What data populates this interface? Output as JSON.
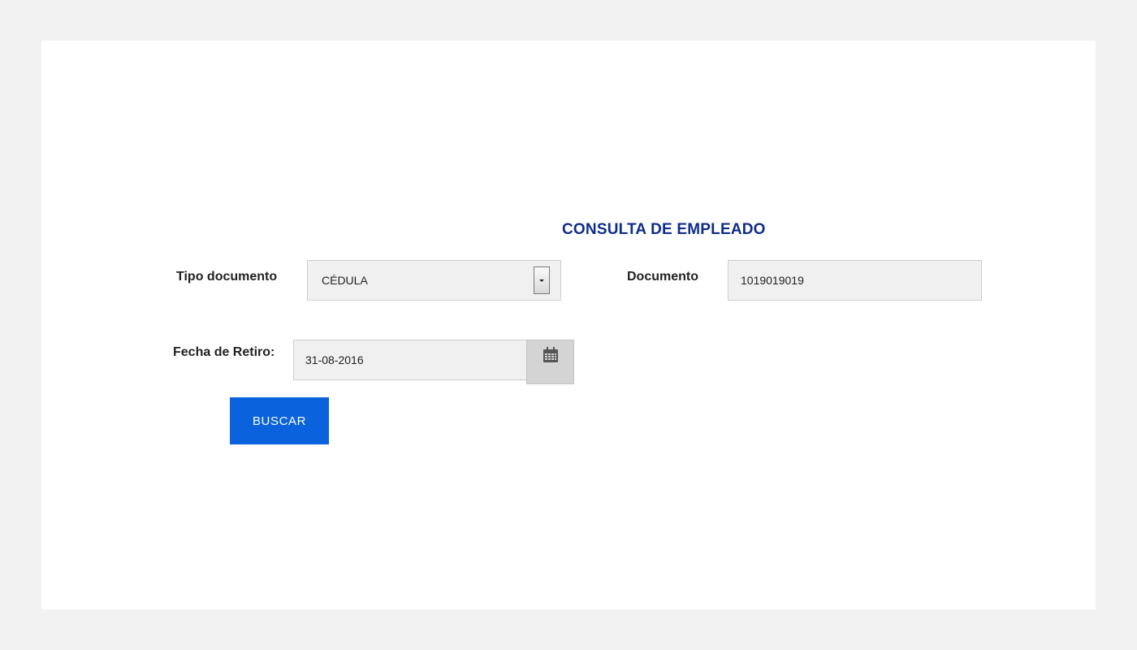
{
  "form": {
    "title": "CONSULTA DE EMPLEADO",
    "tipo_documento": {
      "label": "Tipo documento",
      "selected": "CÉDULA"
    },
    "documento": {
      "label": "Documento",
      "value": "1019019019"
    },
    "fecha_retiro": {
      "label": "Fecha de Retiro:",
      "value": "31-08-2016"
    },
    "submit_label": "BUSCAR"
  },
  "icons": {
    "select_arrow": "chevron-down-icon",
    "date_picker": "calendar-icon"
  },
  "colors": {
    "title": "#0d2d8a",
    "button": "#0a63dc",
    "field_bg": "#f0f0f0",
    "page_bg": "#f2f2f2"
  }
}
